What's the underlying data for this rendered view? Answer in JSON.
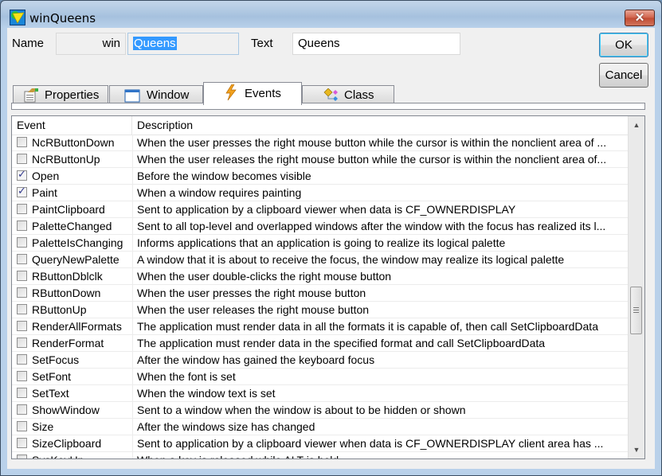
{
  "window": {
    "title": "winQueens",
    "close_label": "✕"
  },
  "header": {
    "name_label": "Name",
    "name_prefix": "win",
    "name_value": "Queens",
    "text_label": "Text",
    "text_value": "Queens",
    "ok_label": "OK",
    "cancel_label": "Cancel"
  },
  "tabs": [
    {
      "label": "Properties",
      "icon": "properties-icon",
      "active": false
    },
    {
      "label": "Window",
      "icon": "window-icon",
      "active": false
    },
    {
      "label": "Events",
      "icon": "lightning-icon",
      "active": true
    },
    {
      "label": "Class",
      "icon": "class-icon",
      "active": false
    }
  ],
  "grid": {
    "columns": [
      "Event",
      "Description"
    ],
    "rows": [
      {
        "event": "NcRButtonDown",
        "checked": false,
        "description": "When the user presses the right mouse button while the cursor is within the nonclient area of ..."
      },
      {
        "event": "NcRButtonUp",
        "checked": false,
        "description": "When the user releases the right mouse button while the cursor is within the nonclient area of..."
      },
      {
        "event": "Open",
        "checked": true,
        "description": "Before the window becomes visible"
      },
      {
        "event": "Paint",
        "checked": true,
        "description": "When a window requires painting"
      },
      {
        "event": "PaintClipboard",
        "checked": false,
        "description": "Sent to application by a clipboard viewer when data is CF_OWNERDISPLAY"
      },
      {
        "event": "PaletteChanged",
        "checked": false,
        "description": "Sent to all top-level and overlapped windows after the window with the focus has realized its l..."
      },
      {
        "event": "PaletteIsChanging",
        "checked": false,
        "description": "Informs applications that an application is going to realize its logical palette"
      },
      {
        "event": "QueryNewPalette",
        "checked": false,
        "description": "A window that it is about to receive the focus, the window may realize its logical palette"
      },
      {
        "event": "RButtonDblclk",
        "checked": false,
        "description": "When the user double-clicks the right mouse button"
      },
      {
        "event": "RButtonDown",
        "checked": false,
        "description": "When the user presses the right mouse button"
      },
      {
        "event": "RButtonUp",
        "checked": false,
        "description": "When the user releases the right mouse button"
      },
      {
        "event": "RenderAllFormats",
        "checked": false,
        "description": "The application must render data in all the formats it is capable of, then call SetClipboardData"
      },
      {
        "event": "RenderFormat",
        "checked": false,
        "description": "The application must render data in the specified format and call SetClipboardData"
      },
      {
        "event": "SetFocus",
        "checked": false,
        "description": "After the window has gained the keyboard focus"
      },
      {
        "event": "SetFont",
        "checked": false,
        "description": "When the font is set"
      },
      {
        "event": "SetText",
        "checked": false,
        "description": "When the window text is set"
      },
      {
        "event": "ShowWindow",
        "checked": false,
        "description": "Sent to a window when the window is about to be hidden or shown"
      },
      {
        "event": "Size",
        "checked": false,
        "description": "After the windows size has changed"
      },
      {
        "event": "SizeClipboard",
        "checked": false,
        "description": "Sent to application by a clipboard viewer when data is CF_OWNERDISPLAY client area has ..."
      },
      {
        "event": "SysKeyUp",
        "checked": false,
        "description": "When a key is released while ALT is held"
      }
    ],
    "scroll_position": 0.6
  }
}
